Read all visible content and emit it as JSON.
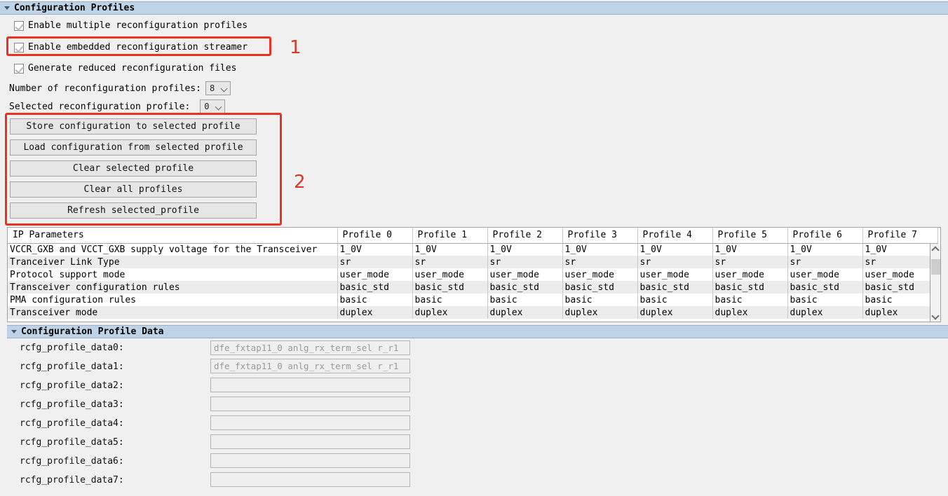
{
  "sections": {
    "profiles": {
      "title": "Configuration Profiles",
      "triangle_icon": "triangle-down-icon"
    },
    "profile_data": {
      "title": "Configuration Profile Data",
      "triangle_icon": "triangle-down-icon"
    }
  },
  "checkboxes": [
    {
      "label": "Enable multiple reconfiguration profiles",
      "checked": true
    },
    {
      "label": "Enable embedded reconfiguration streamer",
      "checked": true
    },
    {
      "label": "Generate reduced reconfiguration files",
      "checked": true
    }
  ],
  "dropdowns": [
    {
      "label": "Number of reconfiguration profiles:",
      "value": "8",
      "chevron_icon": "chevron-down-icon"
    },
    {
      "label": "Selected reconfiguration profile:",
      "value": "0",
      "chevron_icon": "chevron-down-icon"
    }
  ],
  "buttons": [
    "Store configuration to selected profile",
    "Load configuration from selected profile",
    "Clear selected profile",
    "Clear all profiles",
    "Refresh selected_profile"
  ],
  "annotations": [
    {
      "number": "1"
    },
    {
      "number": "2"
    }
  ],
  "table": {
    "headers": [
      "IP Parameters",
      "Profile 0",
      "Profile 1",
      "Profile 2",
      "Profile 3",
      "Profile 4",
      "Profile 5",
      "Profile 6",
      "Profile 7"
    ],
    "rows": [
      {
        "param": "VCCR_GXB and VCCT_GXB supply voltage for the Transceiver",
        "values": [
          "1_0V",
          "1_0V",
          "1_0V",
          "1_0V",
          "1_0V",
          "1_0V",
          "1_0V",
          "1_0V"
        ]
      },
      {
        "param": "Tranceiver Link Type",
        "values": [
          "sr",
          "sr",
          "sr",
          "sr",
          "sr",
          "sr",
          "sr",
          "sr"
        ]
      },
      {
        "param": "Protocol support mode",
        "values": [
          "user_mode",
          "user_mode",
          "user_mode",
          "user_mode",
          "user_mode",
          "user_mode",
          "user_mode",
          "user_mode"
        ]
      },
      {
        "param": "Transceiver configuration rules",
        "values": [
          "basic_std",
          "basic_std",
          "basic_std",
          "basic_std",
          "basic_std",
          "basic_std",
          "basic_std",
          "basic_std"
        ]
      },
      {
        "param": "PMA configuration rules",
        "values": [
          "basic",
          "basic",
          "basic",
          "basic",
          "basic",
          "basic",
          "basic",
          "basic"
        ]
      },
      {
        "param": "Transceiver mode",
        "values": [
          "duplex",
          "duplex",
          "duplex",
          "duplex",
          "duplex",
          "duplex",
          "duplex",
          "duplex"
        ]
      }
    ],
    "scrollbar": {
      "up_icon": "scroll-up-arrow-icon",
      "down_icon": "scroll-down-arrow-icon"
    }
  },
  "profile_data_fields": [
    {
      "label": "rcfg_profile_data0:",
      "value": "dfe_fxtap11_0 anlg_rx_term_sel r_r1"
    },
    {
      "label": "rcfg_profile_data1:",
      "value": "dfe_fxtap11_0 anlg_rx_term_sel r_r1"
    },
    {
      "label": "rcfg_profile_data2:",
      "value": ""
    },
    {
      "label": "rcfg_profile_data3:",
      "value": ""
    },
    {
      "label": "rcfg_profile_data4:",
      "value": ""
    },
    {
      "label": "rcfg_profile_data5:",
      "value": ""
    },
    {
      "label": "rcfg_profile_data6:",
      "value": ""
    },
    {
      "label": "rcfg_profile_data7:",
      "value": ""
    }
  ],
  "colors": {
    "group_header_bg": "#bfd3e6",
    "annotation_red": "#e83323",
    "annotation_number": "#d43a2a",
    "page_bg": "#f0f0f0",
    "row_stripe": "#ececec"
  }
}
